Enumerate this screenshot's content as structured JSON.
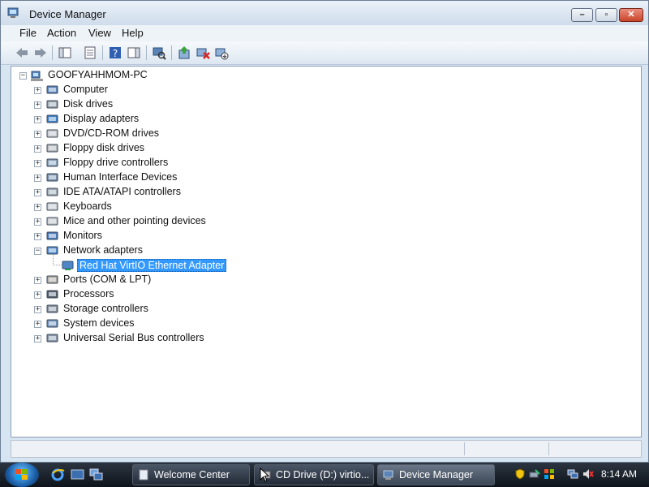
{
  "window": {
    "title": "Device Manager"
  },
  "menu": [
    "File",
    "Action",
    "View",
    "Help"
  ],
  "tree": {
    "root": "GOOFYAHHMOM-PC",
    "categories": [
      {
        "label": "Computer",
        "icon": "computer-icon"
      },
      {
        "label": "Disk drives",
        "icon": "disk-drive-icon"
      },
      {
        "label": "Display adapters",
        "icon": "display-adapter-icon"
      },
      {
        "label": "DVD/CD-ROM drives",
        "icon": "dvd-drive-icon"
      },
      {
        "label": "Floppy disk drives",
        "icon": "floppy-drive-icon"
      },
      {
        "label": "Floppy drive controllers",
        "icon": "floppy-controller-icon"
      },
      {
        "label": "Human Interface Devices",
        "icon": "hid-icon"
      },
      {
        "label": "IDE ATA/ATAPI controllers",
        "icon": "ide-controller-icon"
      },
      {
        "label": "Keyboards",
        "icon": "keyboard-icon"
      },
      {
        "label": "Mice and other pointing devices",
        "icon": "mouse-icon"
      },
      {
        "label": "Monitors",
        "icon": "monitor-icon"
      },
      {
        "label": "Network adapters",
        "icon": "network-adapter-icon",
        "expanded": true
      },
      {
        "label": "Ports (COM & LPT)",
        "icon": "port-icon"
      },
      {
        "label": "Processors",
        "icon": "processor-icon"
      },
      {
        "label": "Storage controllers",
        "icon": "storage-controller-icon"
      },
      {
        "label": "System devices",
        "icon": "system-device-icon"
      },
      {
        "label": "Universal Serial Bus controllers",
        "icon": "usb-icon"
      }
    ],
    "network_child": "Red Hat VirtIO Ethernet Adapter"
  },
  "taskbar": {
    "tasks": [
      "Welcome Center",
      "CD Drive (D:) virtio...",
      "Device Manager"
    ],
    "clock": "8:14 AM"
  },
  "colors": {
    "selection": "#3399ff",
    "taskbar": "#1b222c"
  }
}
